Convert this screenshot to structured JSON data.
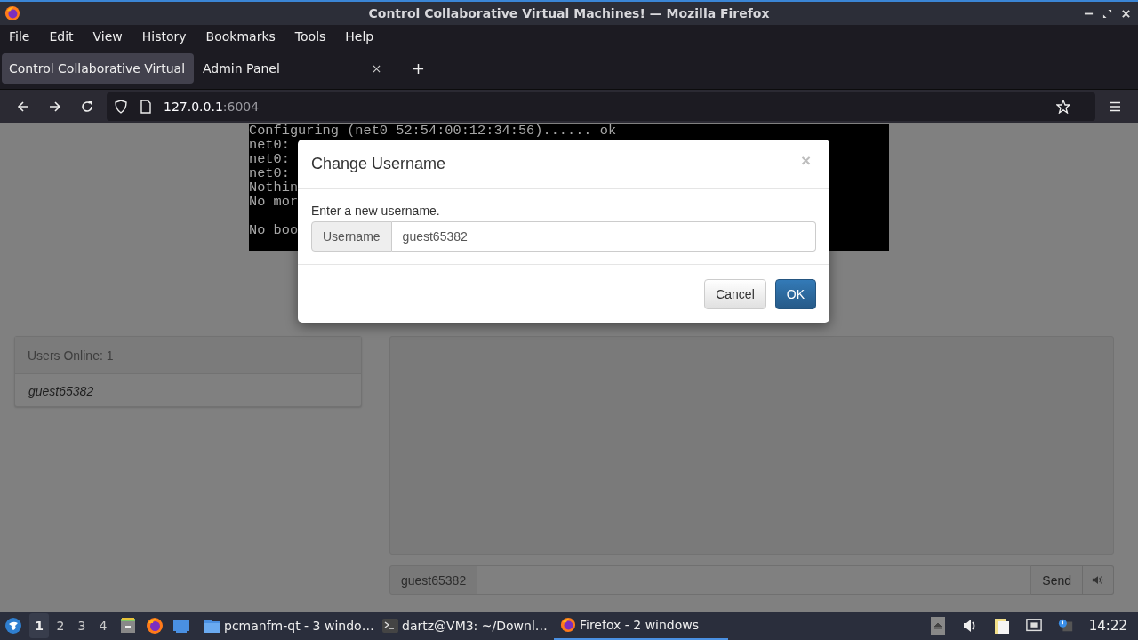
{
  "window": {
    "title": "Control Collaborative Virtual Machines! — Mozilla Firefox"
  },
  "menu": [
    {
      "label": "File"
    },
    {
      "label": "Edit"
    },
    {
      "label": "View"
    },
    {
      "label": "History"
    },
    {
      "label": "Bookmarks"
    },
    {
      "label": "Tools"
    },
    {
      "label": "Help"
    }
  ],
  "tabs": [
    {
      "label": "Control Collaborative Virtual",
      "selected": true
    },
    {
      "label": "Admin Panel",
      "selected": false
    }
  ],
  "address": {
    "host": "127.0.0.1",
    "port": ":6004"
  },
  "terminal": {
    "lines": [
      "Configuring (net0 52:54:00:12:34:56)...... ok",
      "net0:",
      "net0:",
      "net0:",
      "Nothin",
      "No mor"
    ],
    "lines_after_blank": [
      "No boo"
    ]
  },
  "users_panel": {
    "heading": "Users Online: 1",
    "users": [
      "guest65382"
    ]
  },
  "chat": {
    "username": "guest65382",
    "send": "Send"
  },
  "dialog": {
    "title": "Change Username",
    "close": "×",
    "prompt": "Enter a new username.",
    "addon": "Username",
    "value": "guest65382",
    "cancel": "Cancel",
    "ok": "OK"
  },
  "taskbar": {
    "workspaces": [
      {
        "label": "1",
        "selected": true
      },
      {
        "label": "2",
        "selected": false
      },
      {
        "label": "3",
        "selected": false
      },
      {
        "label": "4",
        "selected": false
      }
    ],
    "tasks": [
      {
        "kind": "folder",
        "label": "pcmanfm-qt - 3 windo…",
        "selected": false
      },
      {
        "kind": "terminal",
        "label": "dartz@VM3: ~/Downl…",
        "selected": false
      },
      {
        "kind": "firefox",
        "label": "Firefox - 2 windows",
        "selected": true
      }
    ],
    "clock": "14:22"
  }
}
